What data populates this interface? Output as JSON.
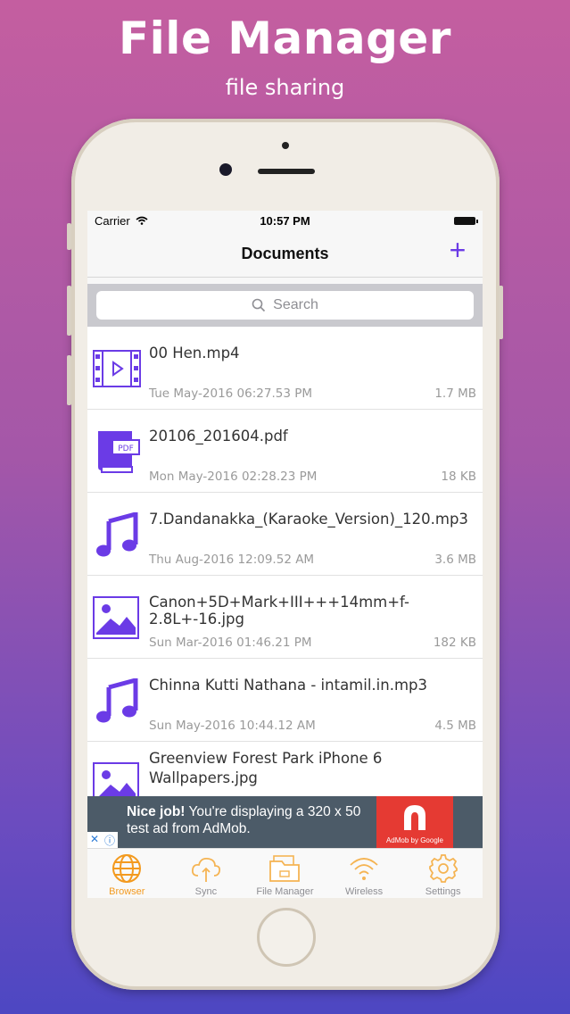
{
  "promo": {
    "title": "File Manager",
    "subtitle": "file sharing"
  },
  "status_bar": {
    "carrier": "Carrier",
    "time": "10:57 PM"
  },
  "nav": {
    "title": "Documents",
    "add_label": "+"
  },
  "search": {
    "placeholder": "Search"
  },
  "files": [
    {
      "name": "00 Hen.mp4",
      "date": "Tue May-2016 06:27.53 PM",
      "size": "1.7 MB",
      "icon": "video-icon"
    },
    {
      "name": "20106_201604.pdf",
      "date": "Mon May-2016 02:28.23 PM",
      "size": "18 KB",
      "icon": "pdf-icon"
    },
    {
      "name": "7.Dandanakka_(Karaoke_Version)_120.mp3",
      "date": "Thu Aug-2016 12:09.52 AM",
      "size": "3.6 MB",
      "icon": "music-icon"
    },
    {
      "name": "Canon+5D+Mark+III+++14mm+f-2.8L+-16.jpg",
      "date": "Sun Mar-2016 01:46.21 PM",
      "size": "182 KB",
      "icon": "image-icon"
    },
    {
      "name": "Chinna Kutti Nathana - intamil.in.mp3",
      "date": "Sun May-2016 10:44.12 AM",
      "size": "4.5 MB",
      "icon": "music-icon"
    },
    {
      "name": "Greenview Forest Park iPhone 6 Wallpapers.jpg",
      "date": "",
      "size": "",
      "icon": "image-icon"
    }
  ],
  "ad": {
    "bold": "Nice job!",
    "text": " You're displaying a 320 x 50 test ad from AdMob.",
    "brand": "AdMob by Google"
  },
  "tabs": [
    {
      "label": "Browser",
      "icon": "globe-icon",
      "active": true
    },
    {
      "label": "Sync",
      "icon": "cloud-sync-icon",
      "active": false
    },
    {
      "label": "File Manager",
      "icon": "folder-icon",
      "active": false
    },
    {
      "label": "Wireless",
      "icon": "wifi-icon",
      "active": false
    },
    {
      "label": "Settings",
      "icon": "gear-icon",
      "active": false
    }
  ],
  "colors": {
    "accent": "#6b3be6",
    "tab_active": "#f39a1f",
    "tab_inactive": "#f5b453"
  }
}
